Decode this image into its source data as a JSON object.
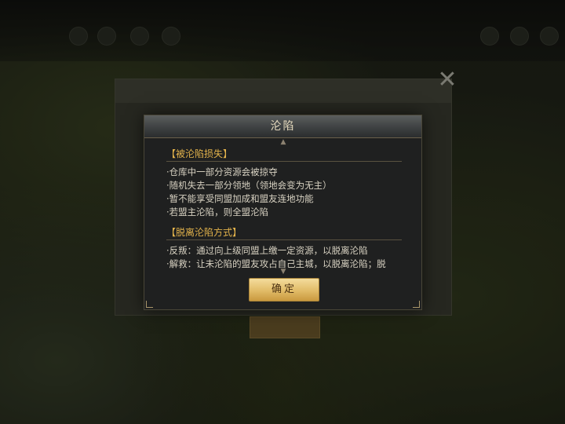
{
  "modal": {
    "title": "沦陷",
    "confirm_label": "确定",
    "sections": [
      {
        "heading": "【被沦陷损失】",
        "lines": [
          "·仓库中一部分资源会被掠夺",
          "·随机失去一部分领地（领地会变为无主）",
          "·暂不能享受同盟加成和盟友连地功能",
          "·若盟主沦陷，则全盟沦陷"
        ]
      },
      {
        "heading": "【脱离沦陷方式】",
        "lines": [
          "·反叛：通过向上级同盟上缴一定资源，以脱离沦陷",
          "·解救：让未沦陷的盟友攻占自己主城，以脱离沦陷；脱"
        ]
      }
    ]
  },
  "colors": {
    "section_heading": "#e2b24b",
    "body_text": "#d8d2c2",
    "button_gold": "#e1bb67"
  },
  "icons": {
    "close": "close-icon",
    "scroll_up": "chevron-up-icon",
    "scroll_down": "chevron-down-icon"
  }
}
